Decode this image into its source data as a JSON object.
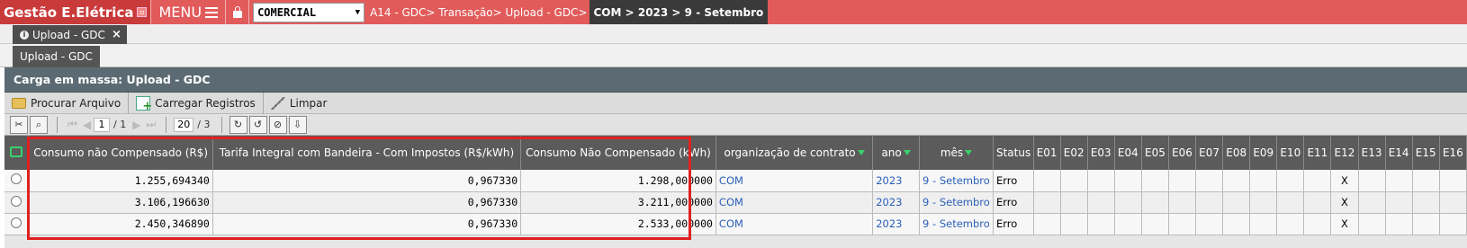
{
  "app": {
    "title": "Gestão E.Elétrica",
    "menu_label": "MENU"
  },
  "topbar": {
    "company_select": "COMERCIAL",
    "breadcrumb": "A14 - GDC> Transação> Upload - GDC>",
    "breadcrumb_current": "COM > 2023 > 9 - Setembro"
  },
  "tabs": [
    {
      "label": "Upload - GDC"
    }
  ],
  "subtab": {
    "label": "Upload - GDC"
  },
  "panel": {
    "title": "Carga em massa: Upload - GDC"
  },
  "actions": {
    "search_file": "Procurar Arquivo",
    "load_records": "Carregar Registros",
    "clear": "Limpar"
  },
  "pager": {
    "page": "1",
    "page_total": "/ 1",
    "page_size": "20",
    "page_size_total": "/ 3"
  },
  "table": {
    "columns": {
      "consumo_nao_comp": "Consumo não Compensado (R$)",
      "tarifa": "Tarifa Integral com Bandeira - Com Impostos (R$/kWh)",
      "consumo_kwh": "Consumo Não Compensado (kWh)",
      "org": "organização de contrato",
      "ano": "ano",
      "mes": "mês",
      "status": "Status",
      "e": [
        "E01",
        "E02",
        "E03",
        "E04",
        "E05",
        "E06",
        "E07",
        "E08",
        "E09",
        "E10",
        "E11",
        "E12",
        "E13",
        "E14",
        "E15",
        "E16"
      ]
    },
    "rows": [
      {
        "consumo_nao_comp": "1.255,694340",
        "tarifa": "0,967330",
        "consumo_kwh": "1.298,000000",
        "org": "COM",
        "ano": "2023",
        "mes": "9 - Setembro",
        "status": "Erro",
        "e12": "X"
      },
      {
        "consumo_nao_comp": "3.106,196630",
        "tarifa": "0,967330",
        "consumo_kwh": "3.211,000000",
        "org": "COM",
        "ano": "2023",
        "mes": "9 - Setembro",
        "status": "Erro",
        "e12": "X"
      },
      {
        "consumo_nao_comp": "2.450,346890",
        "tarifa": "0,967330",
        "consumo_kwh": "2.533,000000",
        "org": "COM",
        "ano": "2023",
        "mes": "9 - Setembro",
        "status": "Erro",
        "e12": "X"
      }
    ]
  },
  "colors": {
    "topbar": "#e25b5b",
    "header": "#5b5b5b",
    "highlight": "#e02020",
    "link": "#2a5fb8"
  }
}
